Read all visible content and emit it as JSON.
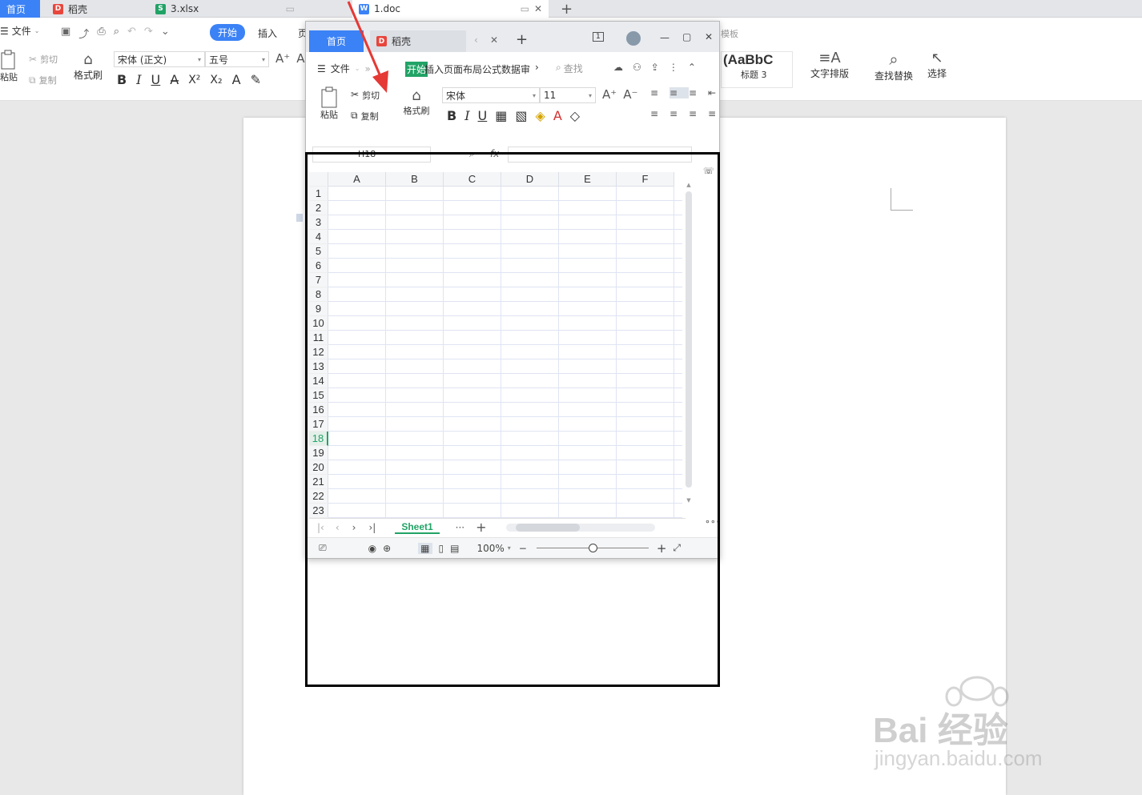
{
  "tabbar": {
    "tabs": [
      {
        "label": "首页",
        "icon": "home"
      },
      {
        "label": "稻壳",
        "icon": "docer-icon"
      },
      {
        "label": "3.xlsx",
        "icon": "spreadsheet-icon"
      },
      {
        "label": "1.doc",
        "icon": "writer-icon"
      }
    ],
    "add_label": "+"
  },
  "ribbon": {
    "file_label": "文件",
    "tabs": [
      "开始",
      "插入",
      "页"
    ],
    "cut_label": "剪切",
    "copy_label": "复制",
    "paste_label": "粘贴",
    "format_painter_label": "格式刷",
    "font_name": "宋体 (正文)",
    "font_size": "五号",
    "template_label": "模板",
    "style_preview": "AaBbC",
    "style_preview_prefix": "(",
    "style_name": "标题 3",
    "text_layout_label": "文字排版",
    "find_replace_label": "查找替换",
    "select_label": "选择"
  },
  "excel": {
    "top_tabs": [
      {
        "label": "首页"
      },
      {
        "label": "稻壳"
      }
    ],
    "add_label": "+",
    "page_count": "1",
    "menu": {
      "file_label": "文件",
      "active_tab": "开始",
      "other_tabs": "插入页面布局公式数据审",
      "search_label": "查找"
    },
    "toolbar": {
      "paste_label": "粘贴",
      "cut_label": "剪切",
      "copy_label": "复制",
      "format_painter_label": "格式刷",
      "font_name": "宋体",
      "font_size": "11"
    },
    "name_box": "H18",
    "fx_label": "fx",
    "columns": [
      "A",
      "B",
      "C",
      "D",
      "E",
      "F"
    ],
    "rows": [
      "1",
      "2",
      "3",
      "4",
      "5",
      "6",
      "7",
      "8",
      "9",
      "10",
      "11",
      "12",
      "13",
      "14",
      "15",
      "16",
      "17",
      "18",
      "19",
      "20",
      "21",
      "22",
      "23"
    ],
    "active_row": "18",
    "sheet_tab": "Sheet1",
    "more_label": "···",
    "zoom": "100%",
    "zoom_level": 0.5
  },
  "colors": {
    "accent": "#3b82f6",
    "excel_green": "#21a366",
    "annotation_red": "#e53935"
  },
  "watermark": {
    "logo_text": "Bai 经验",
    "url": "jingyan.baidu.com"
  }
}
